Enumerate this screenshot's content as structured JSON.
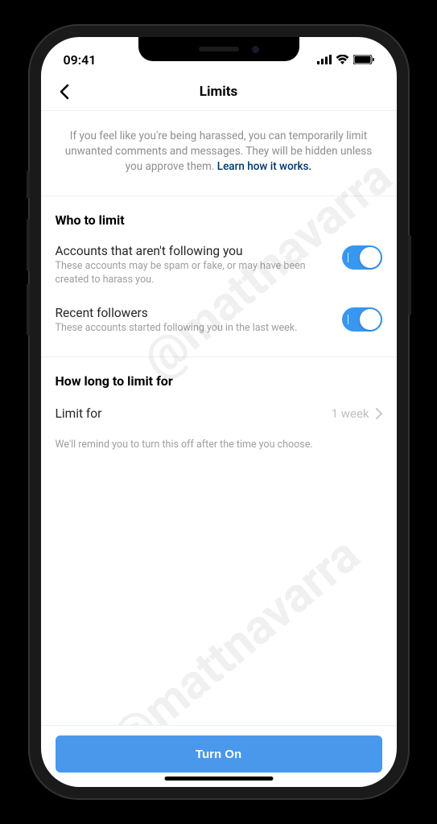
{
  "statusbar": {
    "time": "09:41"
  },
  "header": {
    "title": "Limits"
  },
  "intro": {
    "text": "If you feel like you're being harassed, you can temporarily limit unwanted comments and messages. They will be hidden unless you approve them. ",
    "link": "Learn how it works."
  },
  "who": {
    "heading": "Who to limit",
    "opt1": {
      "title": "Accounts that aren't following you",
      "sub": "These accounts may be spam or fake, or may have been created to harass you."
    },
    "opt2": {
      "title": "Recent followers",
      "sub": "These accounts started following you in the last week."
    }
  },
  "duration": {
    "heading": "How long to limit for",
    "label": "Limit for",
    "value": "1 week",
    "note": "We'll remind you to turn this off after the time you choose."
  },
  "footer": {
    "cta": "Turn On"
  },
  "watermark": "@mattnavarra"
}
